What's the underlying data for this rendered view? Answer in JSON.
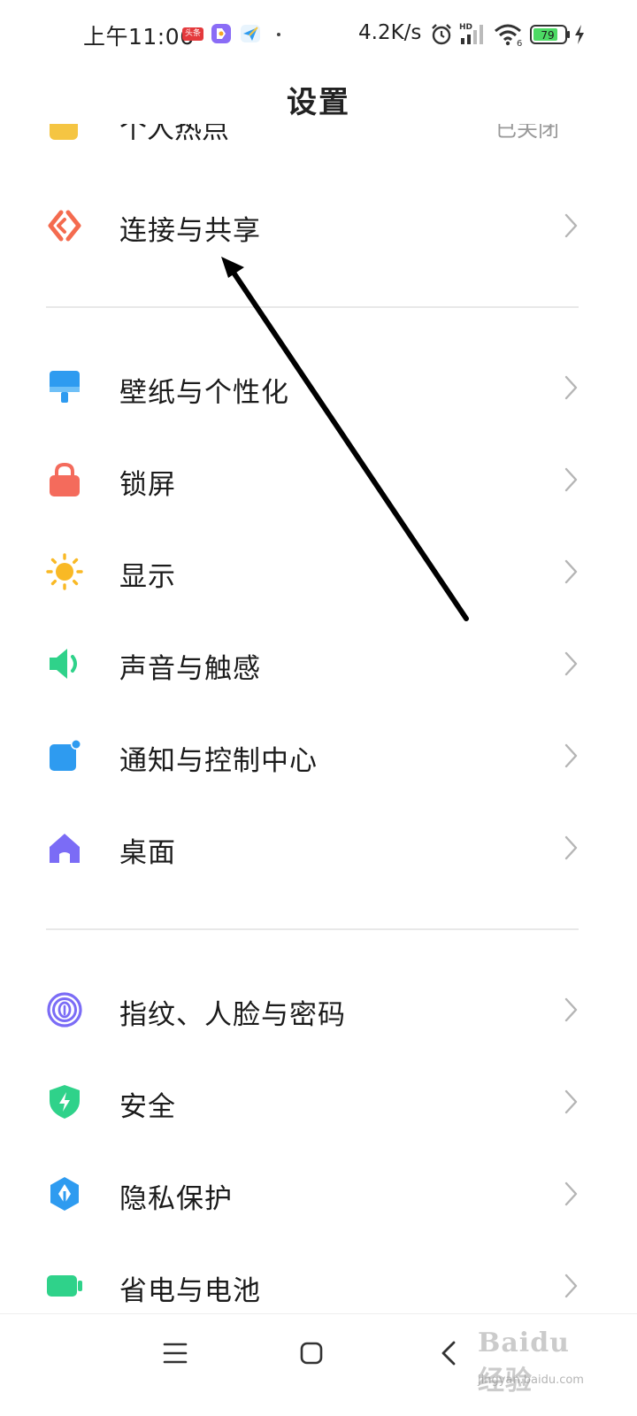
{
  "status_bar": {
    "time": "上午11:06",
    "app_badge_text": "头条",
    "network_speed": "4.2K/s",
    "signal_label": "HD",
    "wifi_label": "6",
    "battery_level": "79",
    "battery_color": "#4cd964"
  },
  "title": "设置",
  "partial_row": {
    "label": "个人热点",
    "value": "已关闭"
  },
  "sections": [
    [
      {
        "label": "连接与共享",
        "icon": "connect-share-icon",
        "color": "#f46b4f"
      }
    ],
    [
      {
        "label": "壁纸与个性化",
        "icon": "wallpaper-icon",
        "color": "#2e9bf0"
      },
      {
        "label": "锁屏",
        "icon": "lock-icon",
        "color": "#f46b5c"
      },
      {
        "label": "显示",
        "icon": "sun-icon",
        "color": "#f9b925"
      },
      {
        "label": "声音与触感",
        "icon": "speaker-icon",
        "color": "#2fd28a"
      },
      {
        "label": "通知与控制中心",
        "icon": "notification-icon",
        "color": "#2e9bf0"
      },
      {
        "label": "桌面",
        "icon": "home-icon",
        "color": "#7b6cf6"
      }
    ],
    [
      {
        "label": "指纹、人脸与密码",
        "icon": "fingerprint-icon",
        "color": "#7b6cf6"
      },
      {
        "label": "安全",
        "icon": "shield-icon",
        "color": "#2fd28a"
      },
      {
        "label": "隐私保护",
        "icon": "privacy-icon",
        "color": "#2e9bf0"
      },
      {
        "label": "省电与电池",
        "icon": "battery-icon",
        "color": "#2fd28a"
      }
    ]
  ],
  "watermark": {
    "brand": "Baidu经验",
    "url": "jingyan.baidu.com"
  }
}
